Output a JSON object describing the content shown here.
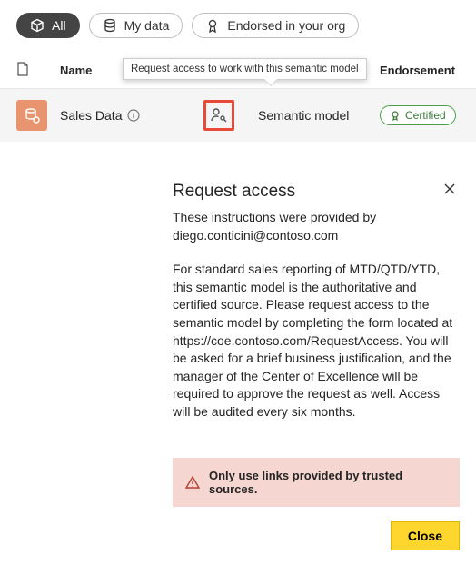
{
  "filters": {
    "all": "All",
    "myData": "My data",
    "endorsed": "Endorsed in your org"
  },
  "columns": {
    "name": "Name",
    "endorsement": "Endorsement"
  },
  "tooltip": "Request access to work with this semantic model",
  "row": {
    "name": "Sales Data",
    "type": "Semantic model",
    "badge": "Certified"
  },
  "popover": {
    "title": "Request access",
    "providedBy": "These instructions were provided by diego.conticini@contoso.com",
    "message": "For standard sales reporting of MTD/QTD/YTD, this semantic model is the authoritative and certified source. Please request access to the semantic model by completing the form located at https://coe.contoso.com/RequestAccess. You will be asked for a brief business justification, and the manager of the Center of Excellence will be required to approve the request as well. Access will be audited every six months.",
    "warning": "Only use links provided by trusted sources.",
    "closeBtn": "Close"
  }
}
